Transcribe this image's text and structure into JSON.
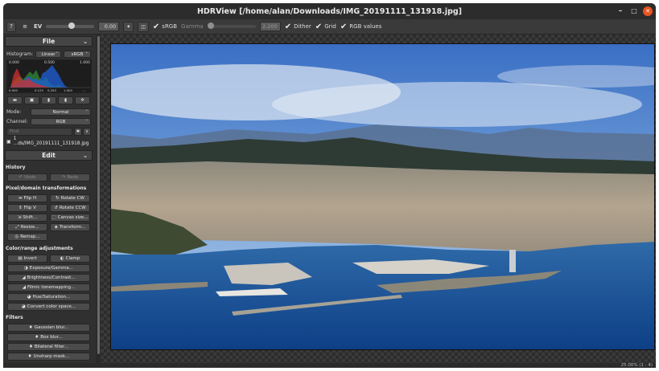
{
  "window": {
    "title": "HDRView [/home/alan/Downloads/IMG_20191111_131918.jpg]",
    "minimize": "–",
    "maximize": "□",
    "close": "✕"
  },
  "toolbar": {
    "help": "?",
    "menu": "≡",
    "ev_label": "EV",
    "ev_value": "0.00",
    "srgb_label": "sRGB",
    "gamma_label": "Gamma",
    "gamma_value": "2.200",
    "dither_label": "Dither",
    "grid_label": "Grid",
    "rgb_values_label": "RGB values"
  },
  "file_panel": {
    "header": "File",
    "histogram_label": "Histogram:",
    "histogram_scale": "Linear",
    "histogram_space": "sRGB",
    "hist_ticks": [
      "0.000",
      "0.500",
      "1.000"
    ],
    "hist_bottom_ticks": [
      "0.000",
      "0.125",
      "0.250",
      "1.000",
      "..."
    ],
    "mode_label": "Mode:",
    "mode_value": "Normal",
    "channel_label": "Channel:",
    "channel_value": "RGB",
    "find_placeholder": "Find",
    "file_entry": "1 ...ds/IMG_20191111_131918.jpg"
  },
  "edit_panel": {
    "header": "Edit",
    "history_label": "History",
    "undo": "Undo",
    "redo": "Redo",
    "pixel_label": "Pixel/domain transformations",
    "flip_h": "Flip H",
    "rotate_cw": "Rotate CW",
    "flip_v": "Flip V",
    "rotate_ccw": "Rotate CCW",
    "shift": "Shift...",
    "canvas_size": "Canvas size...",
    "resize": "Resize...",
    "transform": "Transform...",
    "remap": "Remap...",
    "color_label": "Color/range adjustments",
    "invert": "Invert",
    "clamp": "Clamp",
    "exposure_gamma": "Exposure/Gamma...",
    "brightness_contrast": "Brightness/Contrast...",
    "filmic": "Filmic tonemapping...",
    "hue_saturation": "Hue/Saturation...",
    "convert_color": "Convert color space...",
    "filters_label": "Filters",
    "gaussian_blur": "Gaussian blur...",
    "box_blur": "Box blur...",
    "bilateral_filter": "Bilateral filter...",
    "unsharp_mask": "Unsharp mask..."
  },
  "status": {
    "zoom": "25.00% (1 : 4)"
  },
  "colors": {
    "background": "#2b2b2b",
    "close_button": "#e9541f"
  }
}
